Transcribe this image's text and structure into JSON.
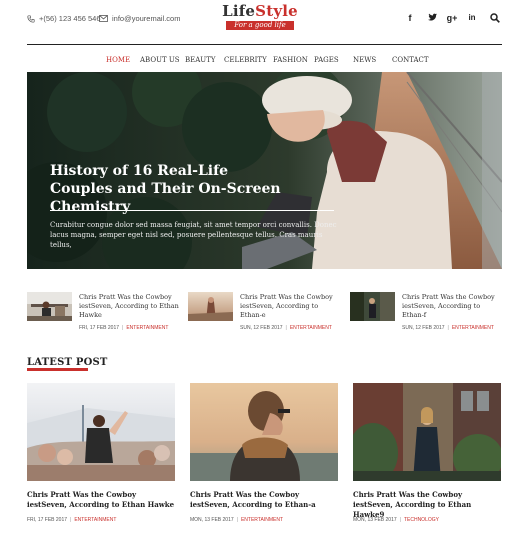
{
  "topbar": {
    "phone": "+(56) 123 456 546",
    "email": "info@youremail.com",
    "logo_part1": "Life",
    "logo_part2": "Style",
    "logo_tagline": "For a good life",
    "social": [
      "f",
      "t",
      "g+",
      "in"
    ]
  },
  "nav": {
    "items": [
      "Home",
      "About Us",
      "Beauty",
      "Celebrity",
      "Fashion",
      "Pages",
      "News",
      "Contact"
    ],
    "active": "Home"
  },
  "hero": {
    "title_line1": "History of 16 Real-Life",
    "title_line2": "Couples and Their On-Screen Chemistry",
    "excerpt": "Curabitur congue dolor sed massa feugiat, sit amet tempor orci convallis. Donec lacus magna, semper eget nisl sed, posuere pellentesque tellus. Cras mauris tellus,"
  },
  "small_posts": [
    {
      "title": "Chris Pratt Was the Cowboy iestSeven, According to Ethan Hawke",
      "date": "FRI, 17 FEB 2017",
      "category": "ENTERTAINMENT"
    },
    {
      "title": "Chris Pratt Was the Cowboy iestSeven, According to Ethan-e",
      "date": "SUN, 12 FEB 2017",
      "category": "ENTERTAINMENT"
    },
    {
      "title": "Chris Pratt Was the Cowboy iestSeven, According to Ethan-f",
      "date": "SUN, 12 FEB 2017",
      "category": "ENTERTAINMENT"
    }
  ],
  "latest": {
    "heading": "LATEST POST",
    "cards": [
      {
        "title": "Chris Pratt Was the Cowboy iestSeven, According to Ethan Hawke",
        "date": "FRI, 17 FEB 2017",
        "category": "ENTERTAINMENT"
      },
      {
        "title": "Chris Pratt Was the Cowboy iestSeven, According to Ethan-a",
        "date": "MON, 13 FEB 2017",
        "category": "ENTERTAINMENT"
      },
      {
        "title": "Chris Pratt Was the Cowboy iestSeven, According to Ethan Hawke9",
        "date": "MON, 13 FEB 2017",
        "category": "TECHNOLOGY"
      }
    ]
  },
  "colors": {
    "accent": "#c9302c",
    "text": "#222222",
    "rule": "#222222"
  },
  "icons": [
    "phone-icon",
    "mail-icon",
    "facebook-icon",
    "twitter-icon",
    "google-plus-icon",
    "linkedin-icon",
    "search-icon"
  ]
}
